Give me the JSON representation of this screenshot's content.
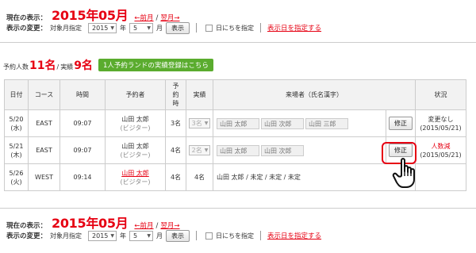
{
  "top_nav": {
    "current_label": "現在の表示：",
    "current_value": "2015年05月",
    "prev_link": "←前月",
    "slash": "/",
    "next_link": "翌月→",
    "change_label": "表示の変更：",
    "target_label": "対象月指定",
    "year_value": "2015",
    "year_unit": "年",
    "month_value": "5",
    "month_unit": "月",
    "show_button": "表示",
    "date_spec_label": "日にちを指定",
    "show_date_link": "表示日を指定する"
  },
  "summary": {
    "reserved_label": "予約人数",
    "reserved_value": "11名",
    "slash": "/",
    "actual_label": "実績",
    "actual_value": "9名",
    "register_button": "1人予約ランドの実績登録はこちら"
  },
  "table": {
    "headers": [
      "日付",
      "コース",
      "時間",
      "予約者",
      "予約時",
      "実績",
      "来場者（氏名漢字）",
      "",
      "状況"
    ],
    "rows": [
      {
        "date": "5/20",
        "dow": "(水)",
        "course": "EAST",
        "time": "09:07",
        "booker": "山田 太郎",
        "booker_kana": "(ビジター)",
        "booker_link": false,
        "reserved": "3名",
        "actual": "3名",
        "visitors": [
          "山田 太郎",
          "山田 次郎",
          "山田 三郎"
        ],
        "edit": "修正",
        "status": "変更なし",
        "status_red": false,
        "status_date": "(2015/05/21)"
      },
      {
        "date": "5/21",
        "dow": "(木)",
        "course": "EAST",
        "time": "09:07",
        "booker": "山田 太郎",
        "booker_kana": "(ビジター)",
        "booker_link": false,
        "reserved": "4名",
        "actual": "2名",
        "visitors": [
          "山田 太郎",
          "山田 次郎"
        ],
        "edit": "修正",
        "status": "人数減",
        "status_red": true,
        "status_date": "(2015/05/21)"
      },
      {
        "date": "5/26",
        "dow": "(火)",
        "course": "WEST",
        "time": "09:14",
        "booker": "山田 太郎",
        "booker_kana": "(ビジター)",
        "booker_link": true,
        "reserved": "4名",
        "actual": "4名",
        "visitors_text": "山田 太郎 / 未定 / 未定 / 未定"
      }
    ]
  },
  "bottom_nav": {
    "current_label": "現在の表示：",
    "current_value": "2015年05月",
    "prev_link": "←前月",
    "slash": "/",
    "next_link": "翌月→",
    "change_label": "表示の変更：",
    "target_label": "対象月指定",
    "year_value": "2015",
    "year_unit": "年",
    "month_value": "5",
    "month_unit": "月",
    "show_button": "表示",
    "date_spec_label": "日にちを指定",
    "show_date_link": "表示日を指定する"
  },
  "colors": {
    "accent": "#e60012",
    "green": "#5aac2e"
  }
}
